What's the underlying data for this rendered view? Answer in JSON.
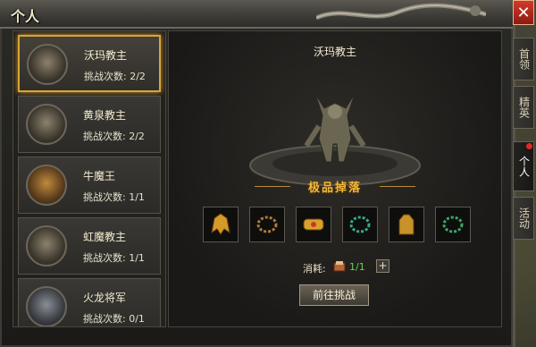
{
  "window": {
    "title": "个人",
    "close_label": "✕"
  },
  "bosses": [
    {
      "name": "沃玛教主",
      "count_label": "挑战次数:",
      "count_value": "2/2",
      "selected": true,
      "icon": "woma-portrait-icon"
    },
    {
      "name": "黄泉教主",
      "count_label": "挑战次数:",
      "count_value": "2/2",
      "selected": false,
      "icon": "huangquan-portrait-icon"
    },
    {
      "name": "牛魔王",
      "count_label": "挑战次数:",
      "count_value": "1/1",
      "selected": false,
      "icon": "niumo-portrait-icon"
    },
    {
      "name": "虹魔教主",
      "count_label": "挑战次数:",
      "count_value": "1/1",
      "selected": false,
      "icon": "hongmo-portrait-icon"
    },
    {
      "name": "火龙将军",
      "count_label": "挑战次数:",
      "count_value": "0/1",
      "selected": false,
      "icon": "huolong-portrait-icon"
    }
  ],
  "detail": {
    "boss_name": "沃玛教主",
    "drop_title": "极品掉落",
    "items": [
      {
        "icon": "helmet-icon"
      },
      {
        "icon": "necklace-icon"
      },
      {
        "icon": "bracer-icon"
      },
      {
        "icon": "necklace-icon"
      },
      {
        "icon": "armor-icon"
      },
      {
        "icon": "necklace-icon"
      }
    ],
    "consume_label": "消耗:",
    "consume_value": "1/1",
    "plus_label": "+",
    "go_button": "前往挑战"
  },
  "tabs": [
    {
      "label": "首领",
      "active": false
    },
    {
      "label": "精英",
      "active": false
    },
    {
      "label": "个人",
      "active": true,
      "badge": true
    },
    {
      "label": "活动",
      "active": false
    }
  ],
  "colors": {
    "selected_border": "#d6a638",
    "accent_gold": "#f1b93a",
    "count_green": "#64d25a",
    "close_red": "#d23a2a"
  }
}
